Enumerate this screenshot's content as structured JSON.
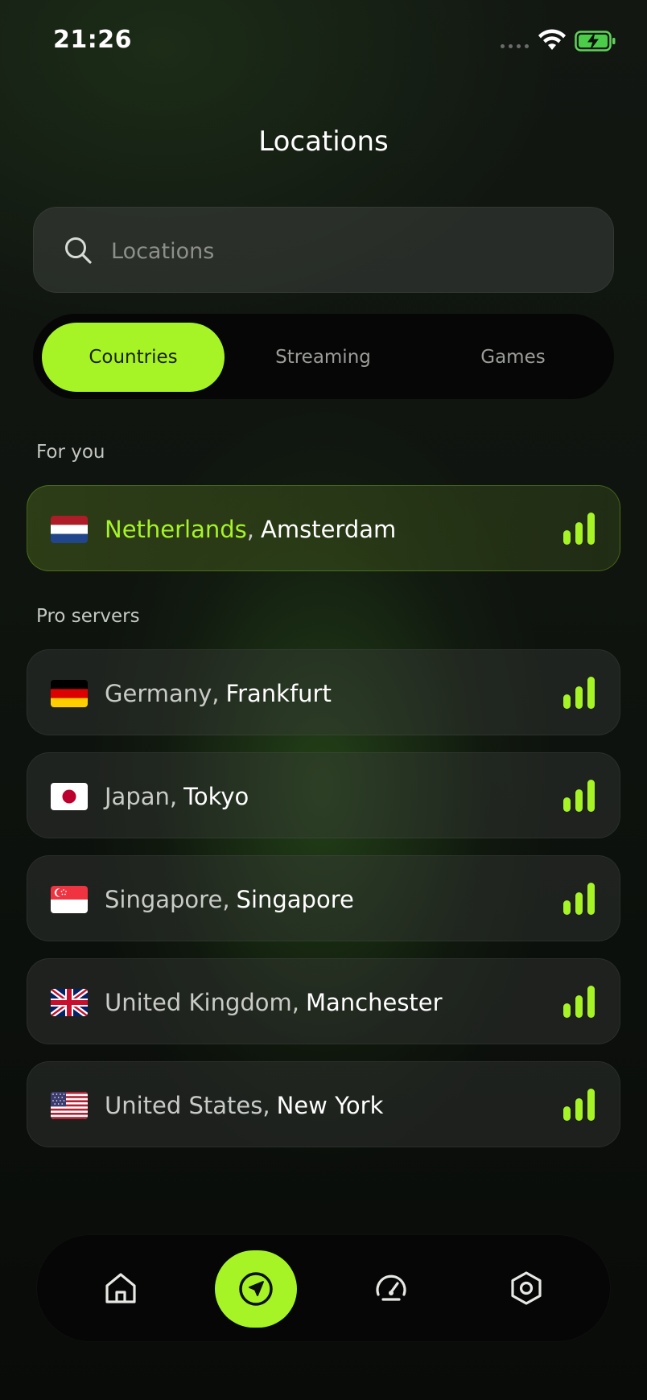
{
  "status_bar": {
    "time": "21:26"
  },
  "header": {
    "title": "Locations"
  },
  "search": {
    "placeholder": "Locations",
    "value": ""
  },
  "tabs": [
    {
      "label": "Countries",
      "active": true
    },
    {
      "label": "Streaming",
      "active": false
    },
    {
      "label": "Games",
      "active": false
    }
  ],
  "sections": {
    "for_you": {
      "label": "For you",
      "items": [
        {
          "country": "Netherlands",
          "city": "Amsterdam",
          "flag": "netherlands-flag",
          "signal": "signal-strong-icon",
          "selected": true
        }
      ]
    },
    "pro_servers": {
      "label": "Pro servers",
      "items": [
        {
          "country": "Germany",
          "city": "Frankfurt",
          "flag": "germany-flag",
          "signal": "signal-strong-icon"
        },
        {
          "country": "Japan",
          "city": "Tokyo",
          "flag": "japan-flag",
          "signal": "signal-strong-icon"
        },
        {
          "country": "Singapore",
          "city": "Singapore",
          "flag": "singapore-flag",
          "signal": "signal-strong-icon"
        },
        {
          "country": "United Kingdom",
          "city": "Manchester",
          "flag": "united-kingdom-flag",
          "signal": "signal-strong-icon"
        },
        {
          "country": "United States",
          "city": "New York",
          "flag": "united-states-flag",
          "signal": "signal-strong-icon"
        }
      ]
    }
  },
  "separator": ",",
  "bottom_nav": [
    {
      "icon": "home-icon",
      "active": false
    },
    {
      "icon": "navigation-arrow-icon",
      "active": true
    },
    {
      "icon": "speedometer-icon",
      "active": false
    },
    {
      "icon": "settings-hexagon-icon",
      "active": false
    }
  ],
  "colors": {
    "accent": "#a6f426",
    "background": "#0e120e",
    "card": "#262a26"
  }
}
